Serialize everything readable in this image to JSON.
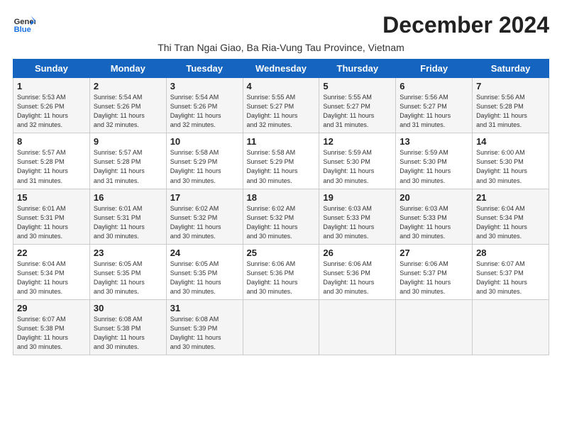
{
  "logo": {
    "line1": "General",
    "line2": "Blue"
  },
  "title": "December 2024",
  "subtitle": "Thi Tran Ngai Giao, Ba Ria-Vung Tau Province, Vietnam",
  "days_of_week": [
    "Sunday",
    "Monday",
    "Tuesday",
    "Wednesday",
    "Thursday",
    "Friday",
    "Saturday"
  ],
  "weeks": [
    [
      {
        "day": "1",
        "info": "Sunrise: 5:53 AM\nSunset: 5:26 PM\nDaylight: 11 hours\nand 32 minutes."
      },
      {
        "day": "2",
        "info": "Sunrise: 5:54 AM\nSunset: 5:26 PM\nDaylight: 11 hours\nand 32 minutes."
      },
      {
        "day": "3",
        "info": "Sunrise: 5:54 AM\nSunset: 5:26 PM\nDaylight: 11 hours\nand 32 minutes."
      },
      {
        "day": "4",
        "info": "Sunrise: 5:55 AM\nSunset: 5:27 PM\nDaylight: 11 hours\nand 32 minutes."
      },
      {
        "day": "5",
        "info": "Sunrise: 5:55 AM\nSunset: 5:27 PM\nDaylight: 11 hours\nand 31 minutes."
      },
      {
        "day": "6",
        "info": "Sunrise: 5:56 AM\nSunset: 5:27 PM\nDaylight: 11 hours\nand 31 minutes."
      },
      {
        "day": "7",
        "info": "Sunrise: 5:56 AM\nSunset: 5:28 PM\nDaylight: 11 hours\nand 31 minutes."
      }
    ],
    [
      {
        "day": "8",
        "info": "Sunrise: 5:57 AM\nSunset: 5:28 PM\nDaylight: 11 hours\nand 31 minutes."
      },
      {
        "day": "9",
        "info": "Sunrise: 5:57 AM\nSunset: 5:28 PM\nDaylight: 11 hours\nand 31 minutes."
      },
      {
        "day": "10",
        "info": "Sunrise: 5:58 AM\nSunset: 5:29 PM\nDaylight: 11 hours\nand 30 minutes."
      },
      {
        "day": "11",
        "info": "Sunrise: 5:58 AM\nSunset: 5:29 PM\nDaylight: 11 hours\nand 30 minutes."
      },
      {
        "day": "12",
        "info": "Sunrise: 5:59 AM\nSunset: 5:30 PM\nDaylight: 11 hours\nand 30 minutes."
      },
      {
        "day": "13",
        "info": "Sunrise: 5:59 AM\nSunset: 5:30 PM\nDaylight: 11 hours\nand 30 minutes."
      },
      {
        "day": "14",
        "info": "Sunrise: 6:00 AM\nSunset: 5:30 PM\nDaylight: 11 hours\nand 30 minutes."
      }
    ],
    [
      {
        "day": "15",
        "info": "Sunrise: 6:01 AM\nSunset: 5:31 PM\nDaylight: 11 hours\nand 30 minutes."
      },
      {
        "day": "16",
        "info": "Sunrise: 6:01 AM\nSunset: 5:31 PM\nDaylight: 11 hours\nand 30 minutes."
      },
      {
        "day": "17",
        "info": "Sunrise: 6:02 AM\nSunset: 5:32 PM\nDaylight: 11 hours\nand 30 minutes."
      },
      {
        "day": "18",
        "info": "Sunrise: 6:02 AM\nSunset: 5:32 PM\nDaylight: 11 hours\nand 30 minutes."
      },
      {
        "day": "19",
        "info": "Sunrise: 6:03 AM\nSunset: 5:33 PM\nDaylight: 11 hours\nand 30 minutes."
      },
      {
        "day": "20",
        "info": "Sunrise: 6:03 AM\nSunset: 5:33 PM\nDaylight: 11 hours\nand 30 minutes."
      },
      {
        "day": "21",
        "info": "Sunrise: 6:04 AM\nSunset: 5:34 PM\nDaylight: 11 hours\nand 30 minutes."
      }
    ],
    [
      {
        "day": "22",
        "info": "Sunrise: 6:04 AM\nSunset: 5:34 PM\nDaylight: 11 hours\nand 30 minutes."
      },
      {
        "day": "23",
        "info": "Sunrise: 6:05 AM\nSunset: 5:35 PM\nDaylight: 11 hours\nand 30 minutes."
      },
      {
        "day": "24",
        "info": "Sunrise: 6:05 AM\nSunset: 5:35 PM\nDaylight: 11 hours\nand 30 minutes."
      },
      {
        "day": "25",
        "info": "Sunrise: 6:06 AM\nSunset: 5:36 PM\nDaylight: 11 hours\nand 30 minutes."
      },
      {
        "day": "26",
        "info": "Sunrise: 6:06 AM\nSunset: 5:36 PM\nDaylight: 11 hours\nand 30 minutes."
      },
      {
        "day": "27",
        "info": "Sunrise: 6:06 AM\nSunset: 5:37 PM\nDaylight: 11 hours\nand 30 minutes."
      },
      {
        "day": "28",
        "info": "Sunrise: 6:07 AM\nSunset: 5:37 PM\nDaylight: 11 hours\nand 30 minutes."
      }
    ],
    [
      {
        "day": "29",
        "info": "Sunrise: 6:07 AM\nSunset: 5:38 PM\nDaylight: 11 hours\nand 30 minutes."
      },
      {
        "day": "30",
        "info": "Sunrise: 6:08 AM\nSunset: 5:38 PM\nDaylight: 11 hours\nand 30 minutes."
      },
      {
        "day": "31",
        "info": "Sunrise: 6:08 AM\nSunset: 5:39 PM\nDaylight: 11 hours\nand 30 minutes."
      },
      null,
      null,
      null,
      null
    ]
  ]
}
